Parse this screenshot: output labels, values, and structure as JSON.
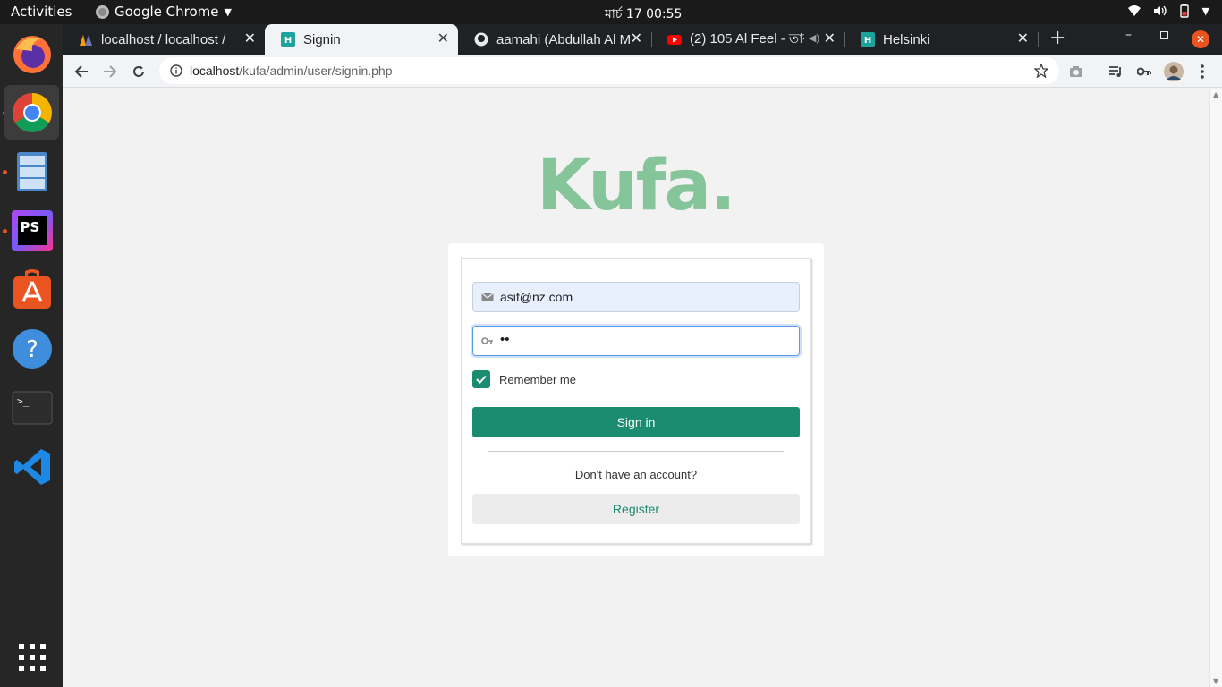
{
  "topbar": {
    "activities": "Activities",
    "app_name": "Google Chrome",
    "clock": "মার্চ 17  00:55",
    "icons": [
      "wifi-icon",
      "volume-icon",
      "battery-icon",
      "power-menu-chevron-icon"
    ]
  },
  "dock": {
    "apps": [
      "firefox-icon",
      "chrome-icon",
      "files-icon",
      "phpstorm-icon",
      "software-center-icon",
      "help-icon",
      "terminal-icon",
      "vscode-icon",
      "app-grid-icon"
    ],
    "phpstorm_label": "PS"
  },
  "tabs": [
    {
      "title": "localhost / localhost / ",
      "favicon": "phpmyadmin-icon"
    },
    {
      "title": "Signin",
      "favicon": "h-icon",
      "active": true
    },
    {
      "title": "aamahi (Abdullah Al M",
      "favicon": "github-icon"
    },
    {
      "title": "(2) 105 Al Feel - তাফ",
      "favicon": "youtube-icon"
    },
    {
      "title": "Helsinki",
      "favicon": "h-icon"
    }
  ],
  "toolbar": {
    "url_host": "localhost",
    "url_path": "/kufa/admin/user/signin.php"
  },
  "page": {
    "logo": "Kufa.",
    "email_value": "asif@nz.com",
    "password_mask": "••",
    "remember_label": "Remember me",
    "signin_label": "Sign in",
    "no_account_text": "Don't have an account?",
    "register_label": "Register"
  },
  "colors": {
    "accent": "#1b8c6f",
    "logo": "#86c49a",
    "ubuntu_orange": "#e95420"
  }
}
